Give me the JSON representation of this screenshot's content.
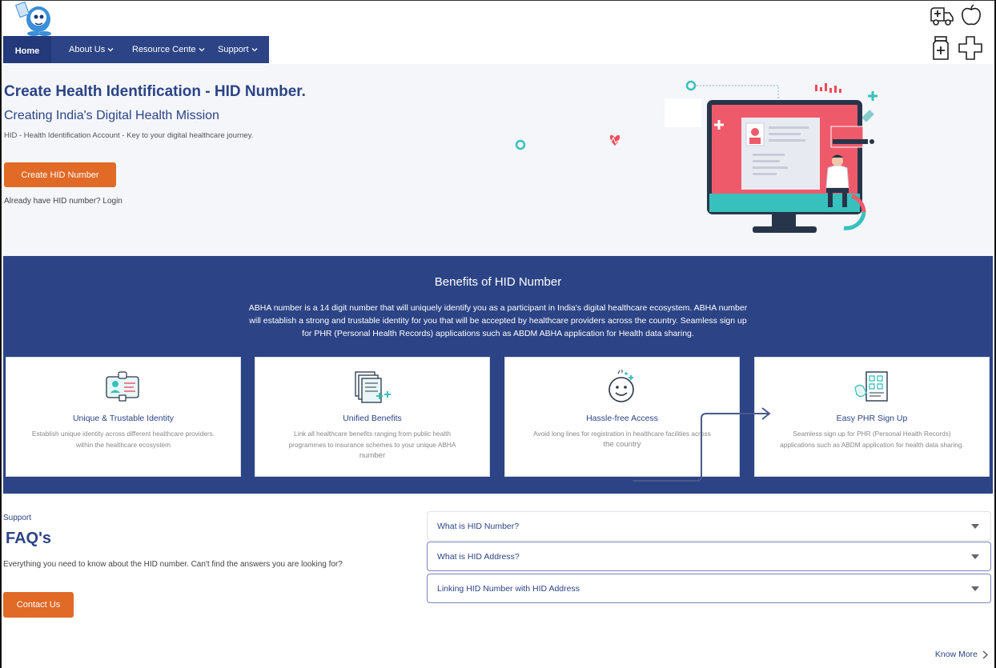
{
  "nav": {
    "home": "Home",
    "about": "About Us",
    "resource": "Resource Cente",
    "support": "Support"
  },
  "hero": {
    "title": "Create Health Identification  - HID Number.",
    "subtitle": "Creating India's Digital Health Mission",
    "description": "HID - Health Identification  Account - Key to your digital healthcare journey.",
    "cta": "Create HID Number",
    "login_text": "Already have HID number? Login"
  },
  "benefits": {
    "title": "Benefits of HID Number",
    "description": "ABHA number is a 14 digit number that will uniquely identify you as a participant in India's digital healthcare ecosystem. ABHA number will establish a strong and trustable identity for you that will be accepted by healthcare providers across the country. Seamless sign up for PHR (Personal Health Records) applications such as ABDM ABHA application for Health data sharing.",
    "cards": [
      {
        "title": "Unique & Trustable Identity",
        "line1": "Establish unique identity across different healthcare providers.",
        "line2": "within the healthcare ecosystem",
        "icon": "id-card-icon"
      },
      {
        "title": "Unified Benefits",
        "line1": "Link all healthcare benefits ranging from public health",
        "line2": "programmes to insurance schemes to your unique ABHA",
        "line3": "number",
        "icon": "documents-icon"
      },
      {
        "title": "Hassle-free Access",
        "line1": "Avoid long lines for registration in healthcare facilities across",
        "line2": "the country",
        "icon": "smiley-icon"
      },
      {
        "title": "Easy PHR Sign Up",
        "line1": "Seamless sign up for PHR (Personal Health Records)",
        "line2": "applications such as ABDM application for health data sharing.",
        "icon": "checklist-icon"
      }
    ]
  },
  "faq": {
    "support_label": "Support",
    "title": "FAQ's",
    "description": "Everything you need to know about the HID number. Can't find the answers you are looking for?",
    "contact": "Contact Us",
    "items": [
      "What is HID Number?",
      "What is HID Address?",
      "Linking HID Number with HID Address"
    ]
  },
  "know_more": "Know More",
  "colors": {
    "primary": "#2c4485",
    "accent": "#e06a26",
    "hero_bg": "#f4f6fa"
  }
}
